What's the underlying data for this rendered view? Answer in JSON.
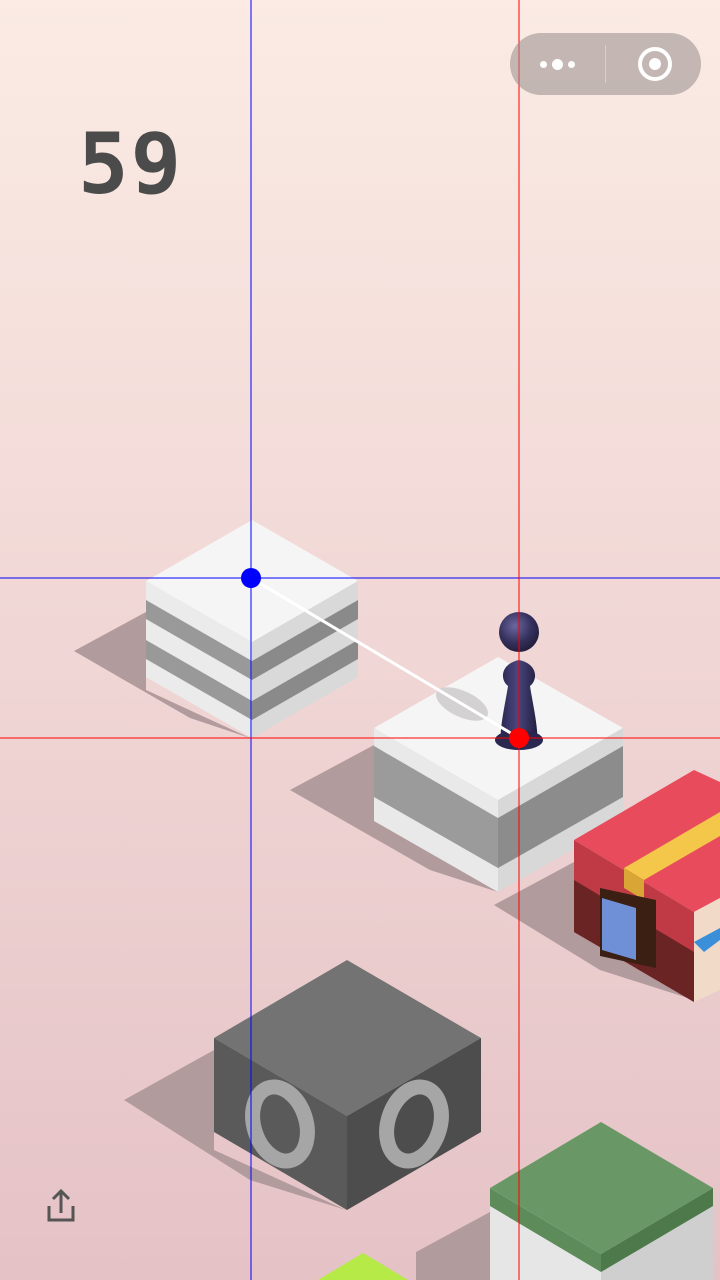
{
  "game": {
    "score": "59",
    "colors": {
      "sky_top": "#fbebe4",
      "sky_bottom": "#e5c2c6",
      "player": "#2e2b52",
      "crosshair_blue": "#0000ff",
      "crosshair_red": "#ff0000"
    }
  },
  "capsule": {
    "more_icon": "more-dots-icon",
    "close_icon": "target-circle-icon"
  },
  "share": {
    "icon": "share-icon"
  }
}
